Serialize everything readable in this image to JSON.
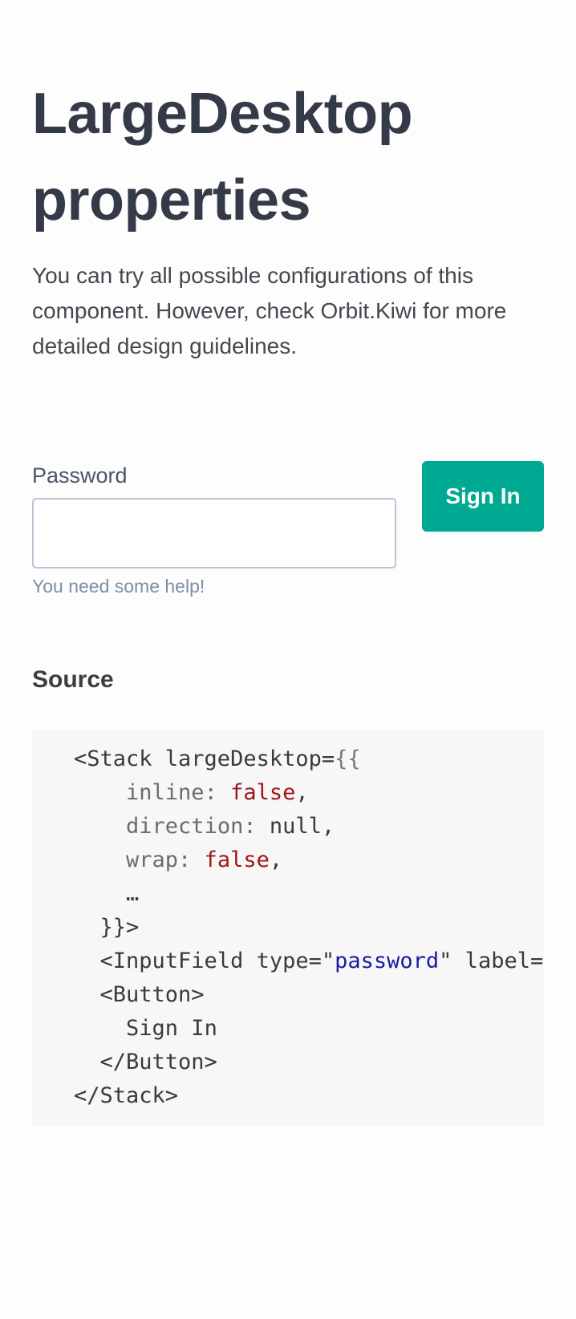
{
  "header": {
    "title_line1": "LargeDesktop",
    "title_line2": "properties",
    "intro": "You can try all possible configurations of this component. However, check Orbit.Kiwi for more detailed design guidelines."
  },
  "demo": {
    "password_field": {
      "label": "Password",
      "value": "",
      "help": "You need some help!"
    },
    "signin_button": {
      "label": "Sign In"
    }
  },
  "source": {
    "heading": "Source",
    "code": {
      "line1_open": "<Stack largeDesktop=",
      "line1_brace": "{{",
      "line2_key": "inline: ",
      "line2_val": "false",
      "line2_end": ",",
      "line3_key": "direction: ",
      "line3_val": "null",
      "line3_end": ",",
      "line4_key": "wrap: ",
      "line4_val": "false",
      "line4_end": ",",
      "line5": "…",
      "line6": "}}>",
      "line7_open": "<InputField type=\"",
      "line7_val": "password",
      "line7_end": "\" label=\"",
      "line8": "<Button>",
      "line9": "Sign In",
      "line10": "</Button>",
      "line11": "</Stack>"
    }
  },
  "colors": {
    "accent": "#00a991",
    "title": "#343a47",
    "help_text": "#7c8ea6",
    "code_background": "#f7f7f7",
    "code_false": "#a31515",
    "code_string": "#1a1aa6"
  }
}
